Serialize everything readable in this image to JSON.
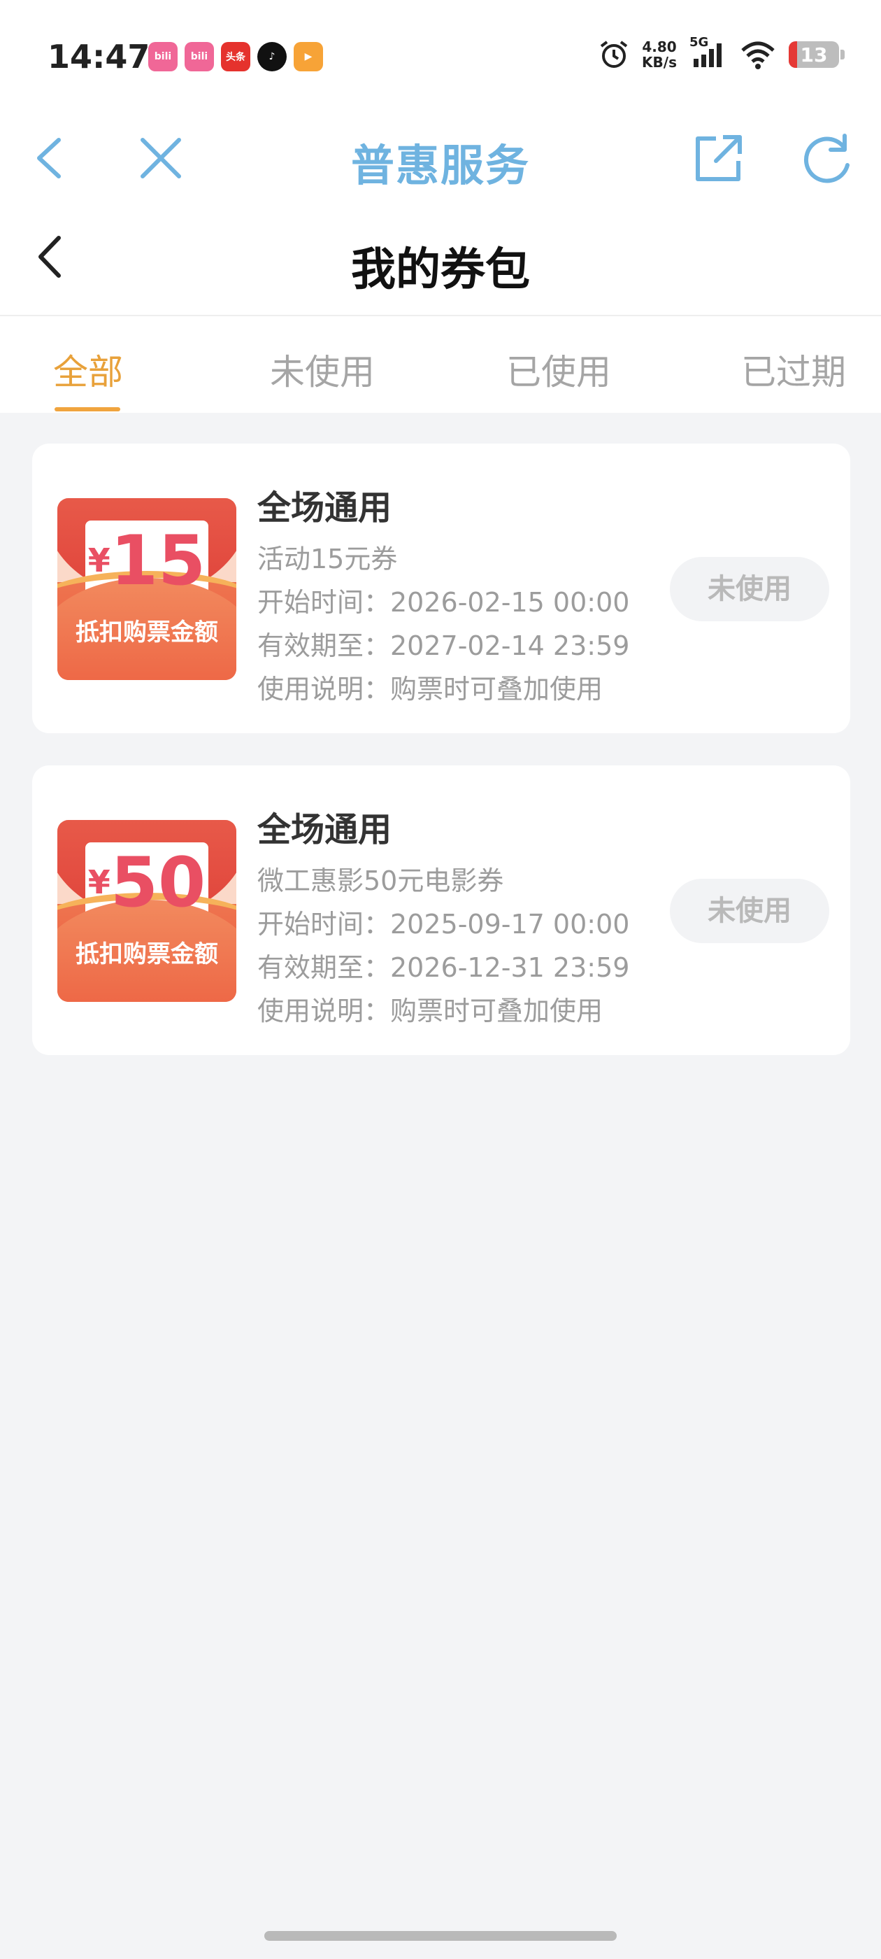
{
  "status_bar": {
    "time": "14:47",
    "net_speed_value": "4.80",
    "net_speed_unit": "KB/s",
    "signal": "5G",
    "battery": "13",
    "apps": [
      {
        "icon": "bilibili-icon",
        "text": "bili",
        "color": "#f06797"
      },
      {
        "icon": "bilibili-icon",
        "text": "bili",
        "color": "#f06797"
      },
      {
        "icon": "toutiao-icon",
        "text": "头条",
        "color": "#e5322d"
      },
      {
        "icon": "tiktok-icon",
        "text": "♪",
        "color": "#111111"
      },
      {
        "icon": "video-app-icon",
        "text": "▶",
        "color": "#f7a337"
      }
    ]
  },
  "navbar": {
    "title": "普惠服务"
  },
  "page": {
    "title": "我的券包"
  },
  "tabs": [
    {
      "label": "全部",
      "active": true
    },
    {
      "label": "未使用",
      "active": false
    },
    {
      "label": "已使用",
      "active": false
    },
    {
      "label": "已过期",
      "active": false
    }
  ],
  "coupons": [
    {
      "yen": "¥",
      "amount": "15",
      "badge_label": "抵扣购票金额",
      "title": "全场通用",
      "subtitle": "活动15元券",
      "start": "开始时间：2026-02-15 00:00",
      "expire": "有效期至：2027-02-14 23:59",
      "note": "使用说明：购票时可叠加使用",
      "status": "未使用"
    },
    {
      "yen": "¥",
      "amount": "50",
      "badge_label": "抵扣购票金额",
      "title": "全场通用",
      "subtitle": "微工惠影50元电影券",
      "start": "开始时间：2025-09-17 00:00",
      "expire": "有效期至：2026-12-31 23:59",
      "note": "使用说明：购票时可叠加使用",
      "status": "未使用"
    }
  ],
  "colors": {
    "accent_tab": "#e8a13a",
    "nav_blue": "#6fb3e0",
    "coupon_red": "#e94f63"
  }
}
